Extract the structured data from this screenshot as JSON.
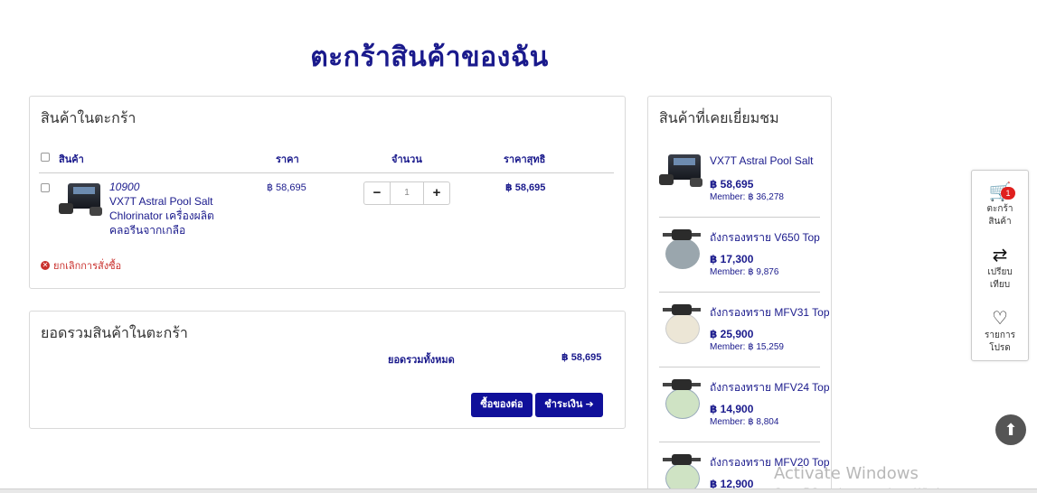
{
  "page": {
    "title": "ตะกร้าสินค้าของฉัน"
  },
  "cart": {
    "heading": "สินค้าในตะกร้า",
    "columns": {
      "product": "สินค้า",
      "price": "ราคา",
      "quantity": "จำนวน",
      "net_price": "ราคาสุทธิ"
    },
    "items": [
      {
        "code": "10900",
        "name": "VX7T Astral Pool Salt Chlorinator เครื่องผลิตคลอรีนจากเกลือ",
        "price": "฿ 58,695",
        "quantity": "1",
        "net_price": "฿ 58,695",
        "minus": "−",
        "plus": "+"
      }
    ],
    "cancel_label": "ยกเลิกการสั่งซื้อ"
  },
  "summary": {
    "heading": "ยอดรวมสินค้าในตะกร้า",
    "total_label": "ยอดรวมทั้งหมด",
    "total_value": "฿ 58,695",
    "continue_label": "ซื้อของต่อ",
    "checkout_label": "ชำระเงิน"
  },
  "recent": {
    "heading": "สินค้าที่เคยเยี่ยมชม",
    "items": [
      {
        "name": "VX7T Astral Pool Salt",
        "price": "฿ 58,695",
        "member": "Member: ฿ 36,278",
        "tank_color": "#2c3038"
      },
      {
        "name": "ถังกรองทราย V650 Top",
        "price": "฿ 17,300",
        "member": "Member: ฿ 9,876",
        "tank_color": "#9aa6ad"
      },
      {
        "name": "ถังกรองทราย MFV31 Top",
        "price": "฿ 25,900",
        "member": "Member: ฿ 15,259",
        "tank_color": "#ece6d6"
      },
      {
        "name": "ถังกรองทราย MFV24 Top",
        "price": "฿ 14,900",
        "member": "Member: ฿ 8,804",
        "tank_color": "#cfe3c4"
      },
      {
        "name": "ถังกรองทราย MFV20 Top",
        "price": "฿ 12,900",
        "member": "",
        "tank_color": "#cfe3c4"
      }
    ]
  },
  "toolbar": {
    "cart_label_1": "ตะกร้า",
    "cart_label_2": "สินค้า",
    "cart_count": "1",
    "compare_label_1": "เปรียบ",
    "compare_label_2": "เทียบ",
    "wishlist_label_1": "รายการ",
    "wishlist_label_2": "โปรด"
  },
  "watermark": {
    "line1": "Activate Windows",
    "line2": "Go to PC settings to activate Windows."
  }
}
